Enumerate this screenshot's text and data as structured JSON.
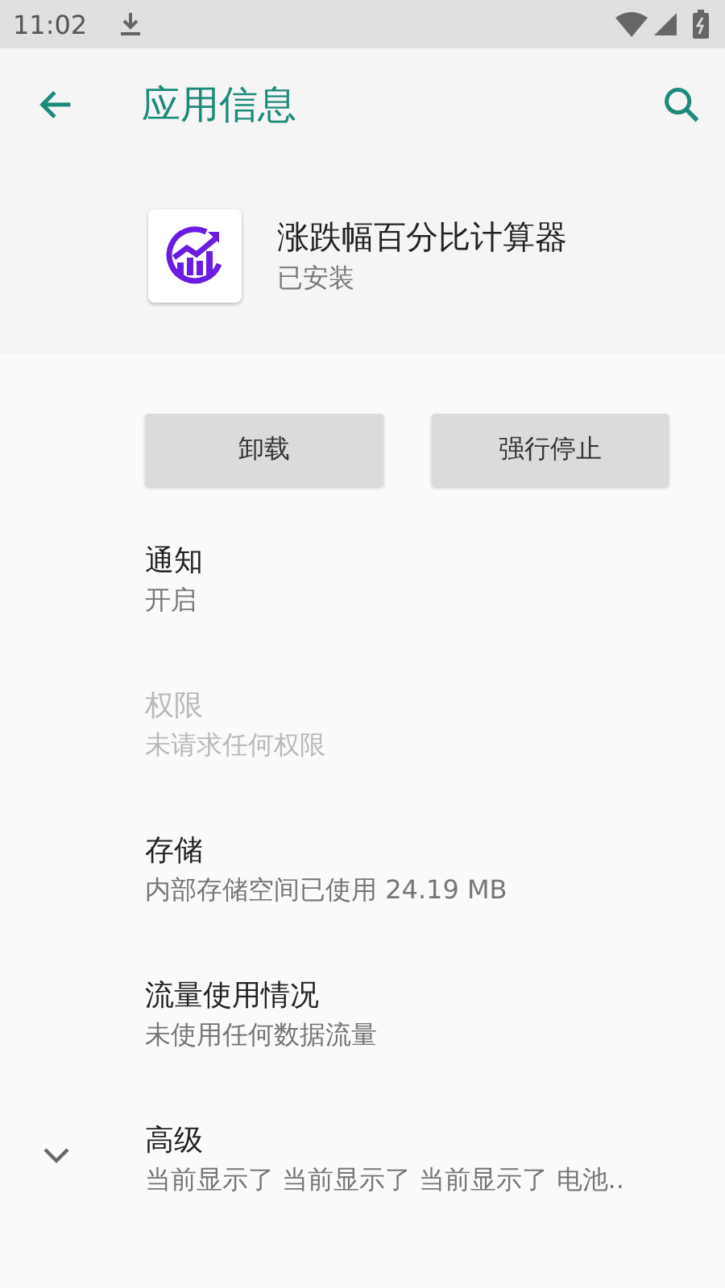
{
  "status_bar": {
    "time": "11:02"
  },
  "toolbar": {
    "title": "应用信息"
  },
  "app": {
    "name": "涨跌幅百分比计算器",
    "status": "已安装"
  },
  "buttons": [
    {
      "label": "卸载"
    },
    {
      "label": "强行停止"
    }
  ],
  "preferences": [
    {
      "kind": "plain",
      "title": "通知",
      "summary": "开启",
      "disabled": false
    },
    {
      "kind": "plain",
      "title": "权限",
      "summary": "未请求任何权限",
      "disabled": true
    },
    {
      "kind": "plain",
      "title": "存储",
      "summary": "内部存储空间已使用 24.19 MB",
      "disabled": false
    },
    {
      "kind": "plain",
      "title": "流量使用情况",
      "summary": "未使用任何数据流量",
      "disabled": false
    },
    {
      "kind": "expandable",
      "title": "高级",
      "summary": "当前显示了 当前显示了 当前显示了 电池..",
      "disabled": false
    }
  ]
}
